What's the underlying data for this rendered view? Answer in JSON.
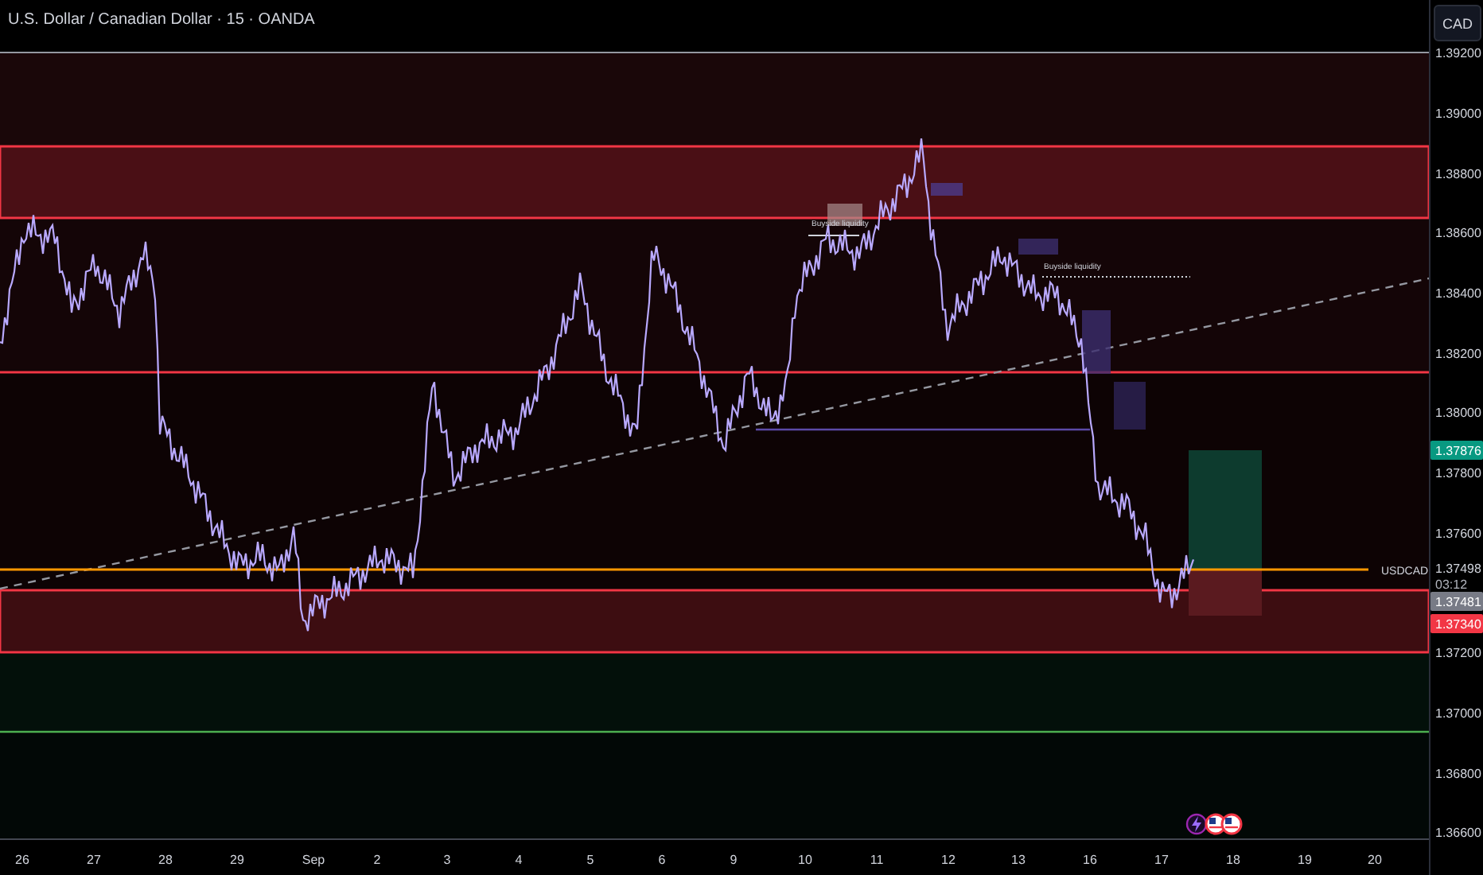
{
  "chart": {
    "title": "U.S. Dollar / Canadian Dollar · 15 · OANDA",
    "symbol_label": "USDCAD",
    "annotations": [
      "Buyside liquidity",
      "Buyside liquidity"
    ]
  },
  "currency_button": "CAD",
  "price_axis": [
    "1.39200",
    "1.39000",
    "1.38800",
    "1.38600",
    "1.38400",
    "1.38200",
    "1.38000",
    "1.37800",
    "1.37600",
    "1.37200",
    "1.37000",
    "1.36800",
    "1.36600"
  ],
  "price_tags": [
    {
      "text": "1.37876",
      "kind": "target"
    },
    {
      "text": "1.37498",
      "kind": "last"
    },
    {
      "text": "03:12",
      "kind": "countdown"
    },
    {
      "text": "1.37481",
      "kind": "marker"
    },
    {
      "text": "1.37340",
      "kind": "stop"
    }
  ],
  "time_axis": [
    "26",
    "27",
    "28",
    "29",
    "Sep",
    "2",
    "3",
    "4",
    "5",
    "6",
    "9",
    "10",
    "11",
    "12",
    "13",
    "16",
    "17",
    "18",
    "19",
    "20"
  ]
}
